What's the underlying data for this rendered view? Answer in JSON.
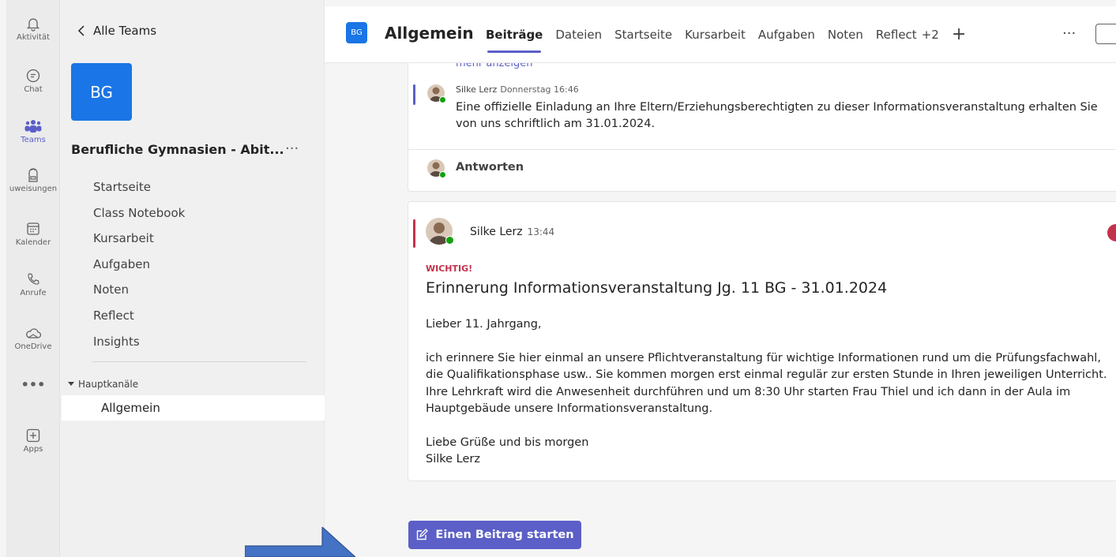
{
  "rail": {
    "items": [
      {
        "label": "Aktivität",
        "icon": "bell-icon"
      },
      {
        "label": "Chat",
        "icon": "chat-icon"
      },
      {
        "label": "Teams",
        "icon": "teams-icon"
      },
      {
        "label": "uweisungen",
        "icon": "backpack-icon"
      },
      {
        "label": "Kalender",
        "icon": "calendar-icon"
      },
      {
        "label": "Anrufe",
        "icon": "phone-icon"
      },
      {
        "label": "OneDrive",
        "icon": "cloud-icon"
      },
      {
        "label": "•••",
        "icon": "more-icon"
      },
      {
        "label": "Apps",
        "icon": "add-apps-icon"
      }
    ]
  },
  "team": {
    "back_label": "Alle Teams",
    "avatar_text": "BG",
    "name": "Berufliche Gymnasien - Abit...",
    "more": "···",
    "nav": [
      "Startseite",
      "Class Notebook",
      "Kursarbeit",
      "Aufgaben",
      "Noten",
      "Reflect",
      "Insights"
    ],
    "channels_label": "Hauptkanäle",
    "active_channel": "Allgemein"
  },
  "header": {
    "avatar_text": "BG",
    "title": "Allgemein",
    "tabs": [
      "Beiträge",
      "Dateien",
      "Startseite",
      "Kursarbeit",
      "Aufgaben",
      "Noten",
      "Reflect",
      "+2"
    ],
    "more": "···"
  },
  "feed": {
    "show_more": "mehr anzeigen",
    "reply": {
      "author": "Silke Lerz",
      "time": "Donnerstag 16:46",
      "text": "Eine offizielle Einladung an Ihre Eltern/Erziehungsberechtigten zu dieser Informationsveranstaltung erhalten Sie von uns schriftlich am 31.01.2024."
    },
    "reply_button": "Antworten",
    "post": {
      "author": "Silke Lerz",
      "time": "13:44",
      "flag": "WICHTIG!",
      "title": "Erinnerung Informationsveranstaltung Jg. 11 BG - 31.01.2024",
      "greeting": "Lieber 11. Jahrgang,",
      "body": "ich erinnere Sie hier einmal an unsere Pflichtveranstaltung für wichtige Informationen rund um die Prüfungsfachwahl, die Qualifikationsphase usw.. Sie kommen morgen erst einmal regulär zur ersten Stunde in Ihren jeweiligen Unterricht. Ihre Lehrkraft wird die Anwesenheit durchführen und um 8:30 Uhr starten Frau Thiel und ich dann in der Aula im Hauptgebäude unsere Informationsveranstaltung.",
      "closing": "Liebe Grüße und bis morgen",
      "signature": "Silke Lerz"
    }
  },
  "compose": {
    "label": "Einen Beitrag starten"
  },
  "colors": {
    "accent": "#5b5fc7",
    "team_blue": "#1a75e6",
    "important_red": "#c4314b",
    "presence_green": "#13a10e",
    "arrow_blue": "#4472c4"
  }
}
